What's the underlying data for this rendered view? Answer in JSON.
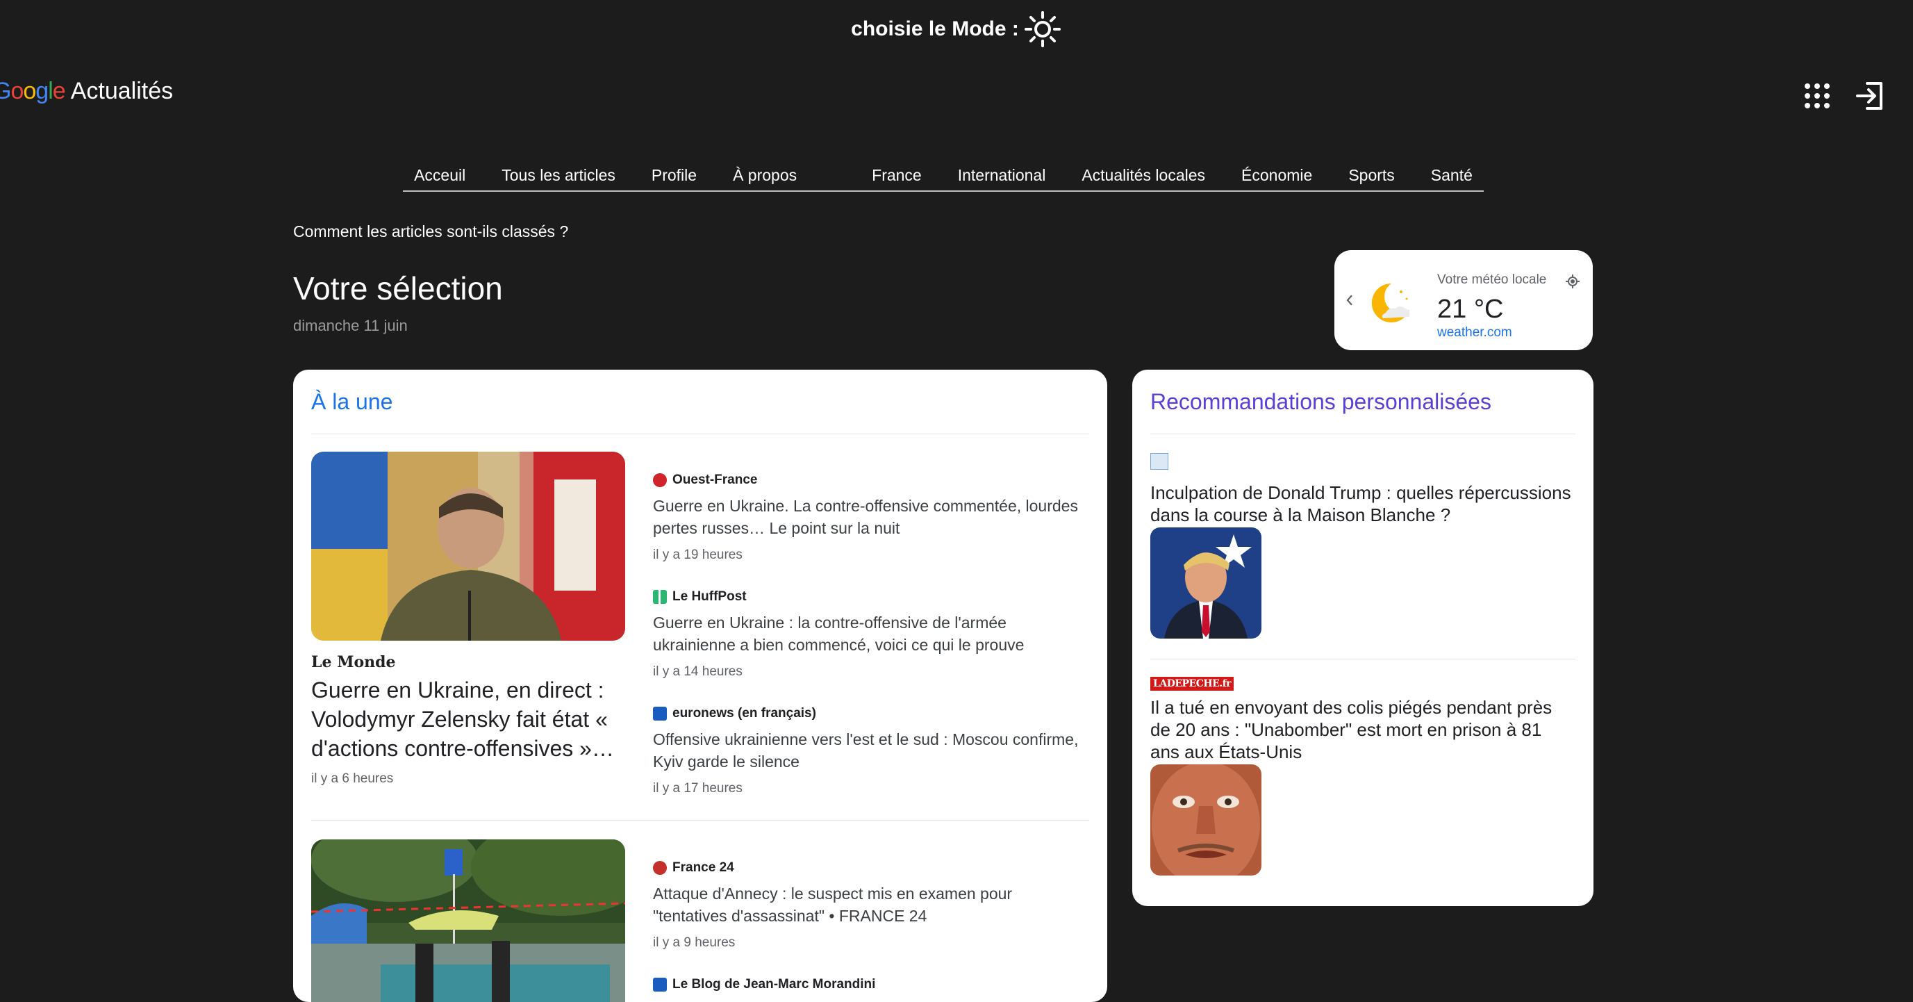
{
  "mode_toggle": {
    "label": "choisie le Mode :",
    "icon": "sun-icon"
  },
  "header": {
    "logo_letters": [
      "G",
      "o",
      "o",
      "g",
      "l",
      "e"
    ],
    "title": "Actualités",
    "apps_icon": "apps-grid-icon",
    "login_icon": "sign-in-icon"
  },
  "nav": {
    "items_left": [
      "Acceuil",
      "Tous les articles",
      "Profile",
      "À propos"
    ],
    "items_right": [
      "France",
      "International",
      "Actualités locales",
      "Économie",
      "Sports",
      "Santé"
    ]
  },
  "intro": {
    "ranking_link": "Comment les articles sont-ils classés ?",
    "title": "Votre sélection",
    "date": "dimanche 11 juin"
  },
  "weather": {
    "label": "Votre météo locale",
    "temp": "21 °C",
    "source": "weather.com"
  },
  "top_stories": {
    "title": "À la une",
    "clusters": [
      {
        "lead": {
          "publisher": "Le Monde",
          "title": "Guerre en Ukraine, en direct : Volodymyr Zelensky fait état « d'actions contre-offensives »…",
          "time": "il y a 6 heures"
        },
        "related": [
          {
            "publisher": "Ouest-France",
            "title": "Guerre en Ukraine. La contre-offensive commentée, lourdes pertes russes… Le point sur la nuit",
            "time": "il y a 19 heures",
            "color": "#d0232a"
          },
          {
            "publisher": "Le HuffPost",
            "title": "Guerre en Ukraine : la contre-offensive de l'armée ukrainienne a bien commencé, voici ce qui le prouve",
            "time": "il y a 14 heures",
            "color": "#2bb673"
          },
          {
            "publisher": "euronews (en français)",
            "title": "Offensive ukrainienne vers l'est et le sud : Moscou confirme, Kyiv garde le silence",
            "time": "il y a 17 heures",
            "color": "#1a5bbf"
          }
        ]
      },
      {
        "related": [
          {
            "publisher": "France 24",
            "title": "Attaque d'Annecy : le suspect mis en examen pour \"tentatives d'assassinat\" • FRANCE 24",
            "time": "il y a 9 heures",
            "color": "#c4302b"
          },
          {
            "publisher": "Le Blog de Jean-Marc Morandini",
            "title": "",
            "time": "",
            "color": "#1a5bbf"
          }
        ]
      }
    ]
  },
  "recommendations": {
    "title": "Recommandations personnalisées",
    "items": [
      {
        "title": "Inculpation de Donald Trump : quelles répercussions dans la course à la Maison Blanche ?"
      },
      {
        "publisher_logo": "LADEPECHE.fr",
        "title": "Il a tué en envoyant des colis piégés pendant près de 20 ans : \"Unabomber\" est mort en prison à 81 ans aux États-Unis"
      }
    ]
  }
}
